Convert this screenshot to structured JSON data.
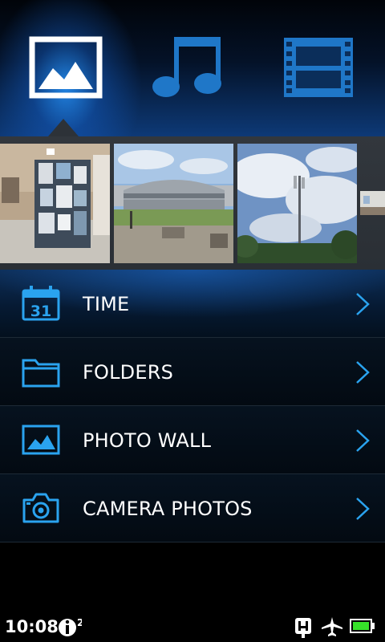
{
  "tabs": [
    {
      "name": "pictures",
      "icon": "picture-icon",
      "selected": true
    },
    {
      "name": "music",
      "icon": "music-note-icon",
      "selected": false
    },
    {
      "name": "videos",
      "icon": "film-strip-icon",
      "selected": false
    }
  ],
  "thumbnails": [
    {
      "name": "thumbnail-notice-board"
    },
    {
      "name": "thumbnail-round-building"
    },
    {
      "name": "thumbnail-sky-lamppost"
    },
    {
      "name": "thumbnail-partial"
    }
  ],
  "list": {
    "items": [
      {
        "label": "TIME",
        "icon": "calendar-icon",
        "icon_text": "31"
      },
      {
        "label": "FOLDERS",
        "icon": "folder-icon"
      },
      {
        "label": "PHOTO WALL",
        "icon": "picture-icon"
      },
      {
        "label": "CAMERA PHOTOS",
        "icon": "camera-icon"
      }
    ]
  },
  "statusbar": {
    "time": "10:08",
    "notification_badge": "2",
    "icons": [
      "info-notification-icon",
      "usb-debugging-icon",
      "airplane-mode-icon",
      "battery-icon"
    ]
  },
  "colors": {
    "accent": "#2aa3ef",
    "tab_selected": "#ffffff",
    "tab_unselected": "#1f77c8",
    "battery_fill": "#37e12a"
  }
}
